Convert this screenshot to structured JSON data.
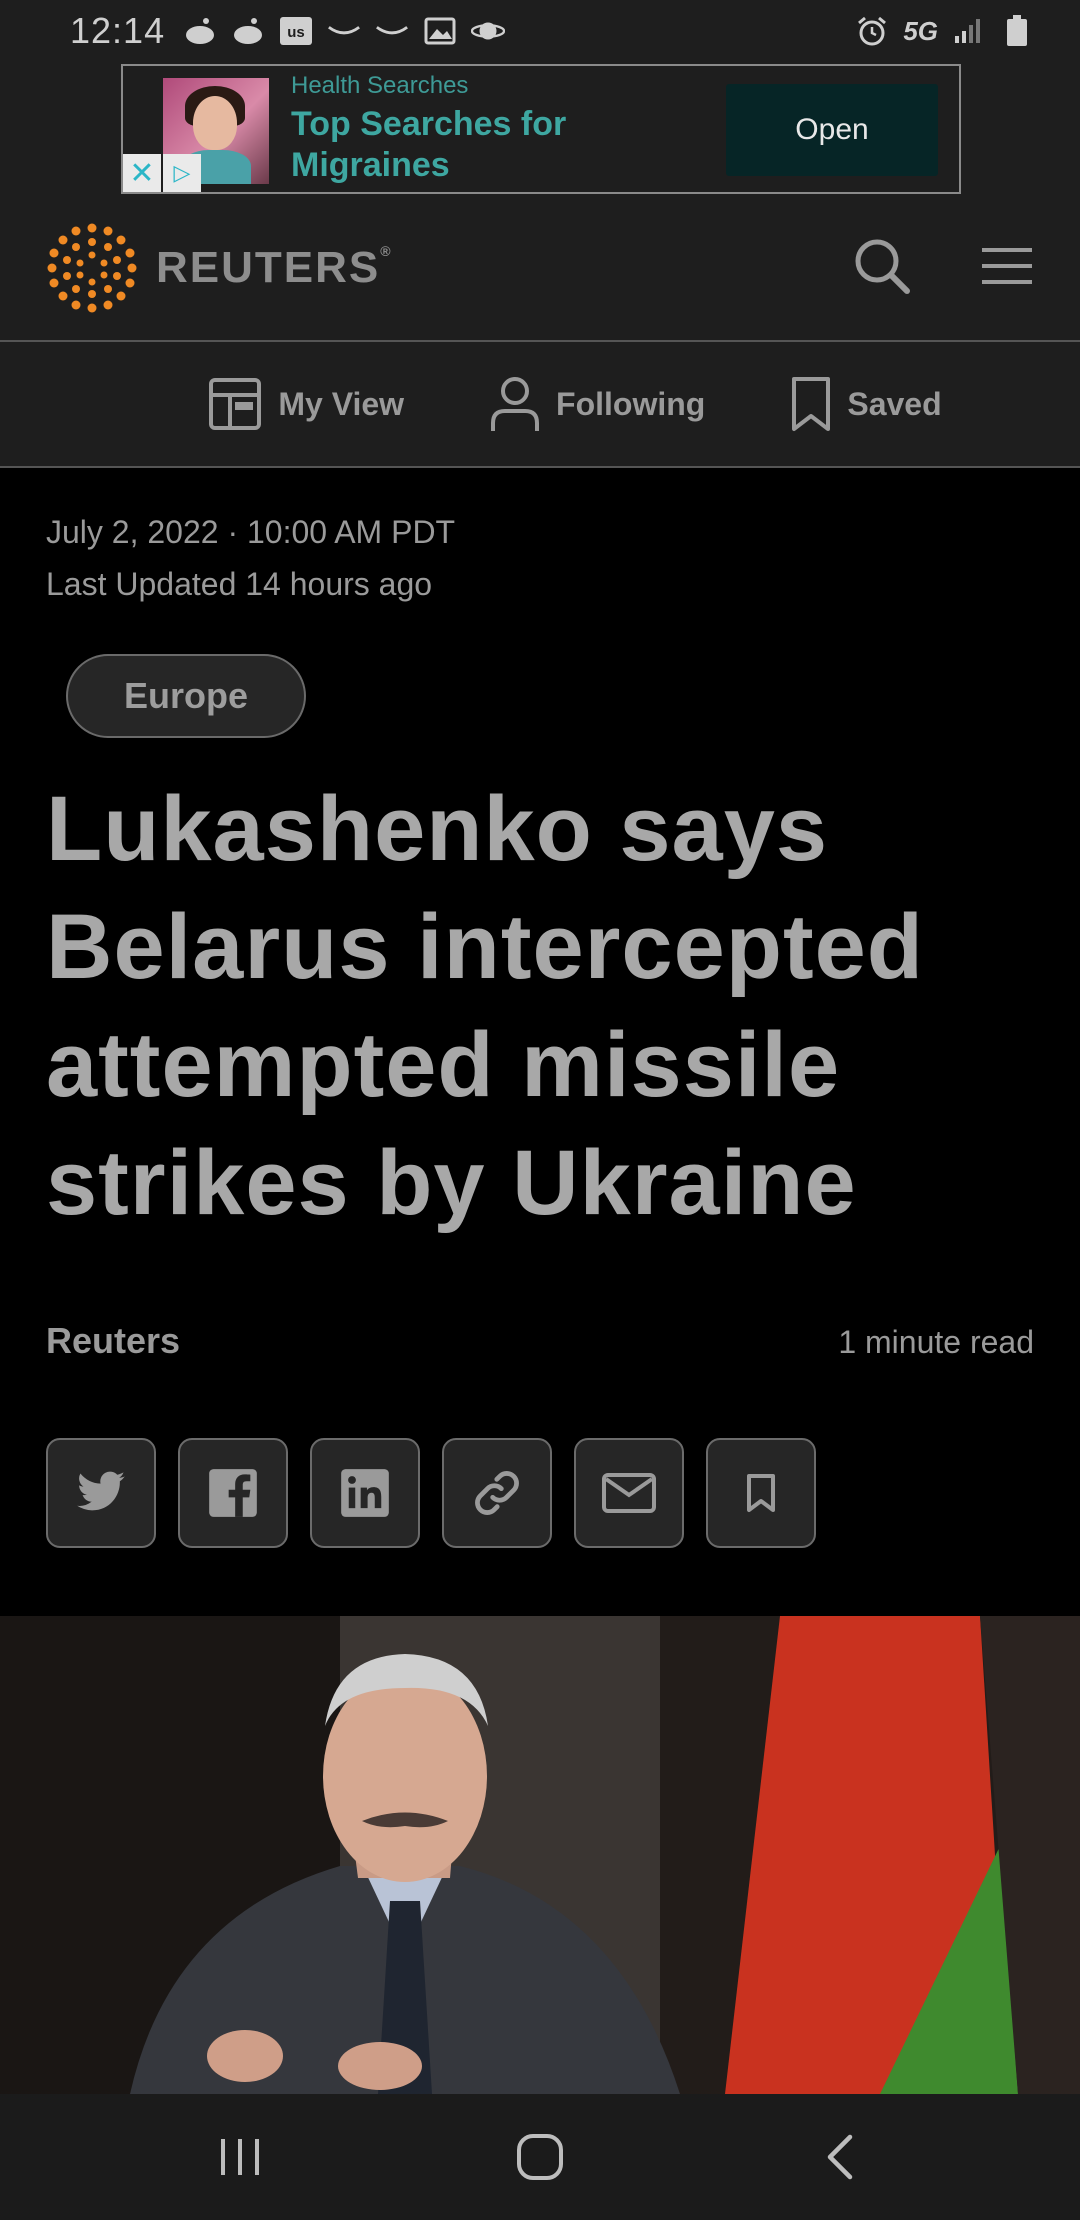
{
  "status_bar": {
    "time": "12:14",
    "network": "5G"
  },
  "ad": {
    "source": "Health Searches",
    "title": "Top Searches for Migraines",
    "cta": "Open"
  },
  "header": {
    "logo_text": "REUTERS",
    "logo_mark": "®"
  },
  "subnav": {
    "items": [
      {
        "label": "My View",
        "icon": "layout-icon"
      },
      {
        "label": "Following",
        "icon": "person-icon"
      },
      {
        "label": "Saved",
        "icon": "bookmark-icon"
      }
    ]
  },
  "article": {
    "date": "July 2, 2022 · 10:00 AM PDT",
    "updated": "Last Updated 14 hours ago",
    "category": "Europe",
    "headline": "Lukashenko says Belarus intercepted attempted missile strikes by Ukraine",
    "byline": "Reuters",
    "read_time": "1 minute read"
  },
  "share": {
    "items": [
      "twitter-icon",
      "facebook-icon",
      "linkedin-icon",
      "link-icon",
      "email-icon",
      "bookmark-icon"
    ]
  },
  "colors": {
    "accent_orange": "#f08a24",
    "ad_teal": "#3ea7a1",
    "flag_red": "#c9321f",
    "flag_green": "#3f8a2e"
  }
}
